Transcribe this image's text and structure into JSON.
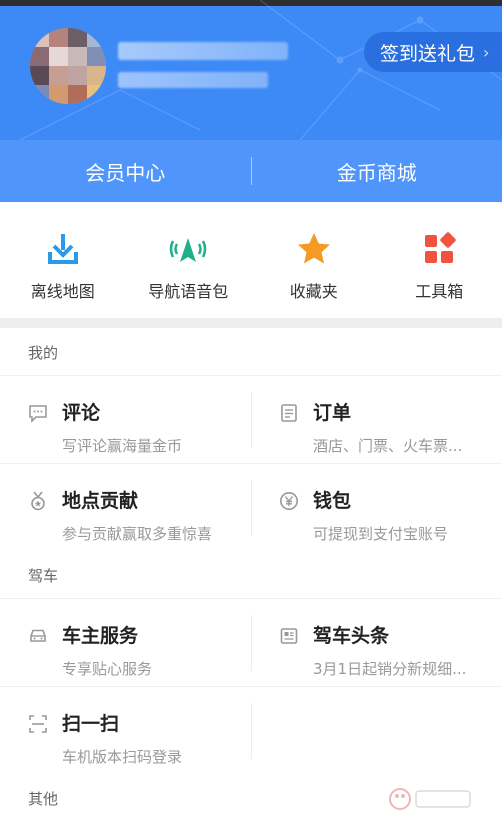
{
  "header": {
    "signin_label": "签到送礼包",
    "signin_arrow": "›"
  },
  "member_bar": {
    "left": "会员中心",
    "right": "金币商城"
  },
  "quick_actions": [
    {
      "label": "离线地图",
      "icon": "download-icon",
      "color": "#2b9ae8"
    },
    {
      "label": "导航语音包",
      "icon": "navigation-voice-icon",
      "color": "#1fb08a"
    },
    {
      "label": "收藏夹",
      "icon": "star-icon",
      "color": "#f59a23"
    },
    {
      "label": "工具箱",
      "icon": "toolbox-icon",
      "color": "#f0533e"
    }
  ],
  "sections": {
    "mine": {
      "title": "我的",
      "items": [
        {
          "title": "评论",
          "subtitle": "写评论赢海量金币",
          "icon": "comment-icon"
        },
        {
          "title": "订单",
          "subtitle": "酒店、门票、火车票...",
          "icon": "order-icon"
        },
        {
          "title": "地点贡献",
          "subtitle": "参与贡献赢取多重惊喜",
          "icon": "medal-icon"
        },
        {
          "title": "钱包",
          "subtitle": "可提现到支付宝账号",
          "icon": "wallet-yen-icon"
        }
      ]
    },
    "driving": {
      "title": "驾车",
      "items": [
        {
          "title": "车主服务",
          "subtitle": "专享贴心服务",
          "icon": "car-icon"
        },
        {
          "title": "驾车头条",
          "subtitle": "3月1日起销分新规细...",
          "icon": "news-icon"
        },
        {
          "title": "扫一扫",
          "subtitle": "车机版本扫码登录",
          "icon": "scan-icon"
        }
      ]
    },
    "other": {
      "title": "其他"
    }
  },
  "colors": {
    "header_bg": "#3d8af7",
    "member_bar_bg": "#4f95fa",
    "signin_bg": "#2a6fe0"
  }
}
